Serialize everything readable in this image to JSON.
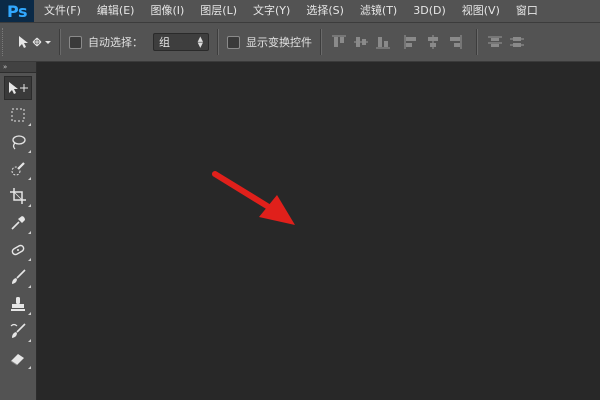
{
  "app": {
    "logo": "Ps"
  },
  "menu": [
    "文件(F)",
    "编辑(E)",
    "图像(I)",
    "图层(L)",
    "文字(Y)",
    "选择(S)",
    "滤镜(T)",
    "3D(D)",
    "视图(V)",
    "窗口"
  ],
  "options": {
    "auto_select_label": "自动选择：",
    "auto_select_value": "组",
    "show_transform_label": "显示变换控件"
  },
  "toolbox": {
    "collapse_glyph": "»",
    "tools": [
      "move-tool-icon",
      "rectangular-marquee-icon",
      "lasso-icon",
      "quick-selection-icon",
      "crop-icon",
      "eyedropper-icon",
      "healing-brush-icon",
      "brush-icon",
      "clone-stamp-icon",
      "history-brush-icon",
      "eraser-icon"
    ]
  },
  "colors": {
    "chrome": "#535353",
    "canvas": "#282828",
    "annotation_arrow": "#e0201b"
  }
}
